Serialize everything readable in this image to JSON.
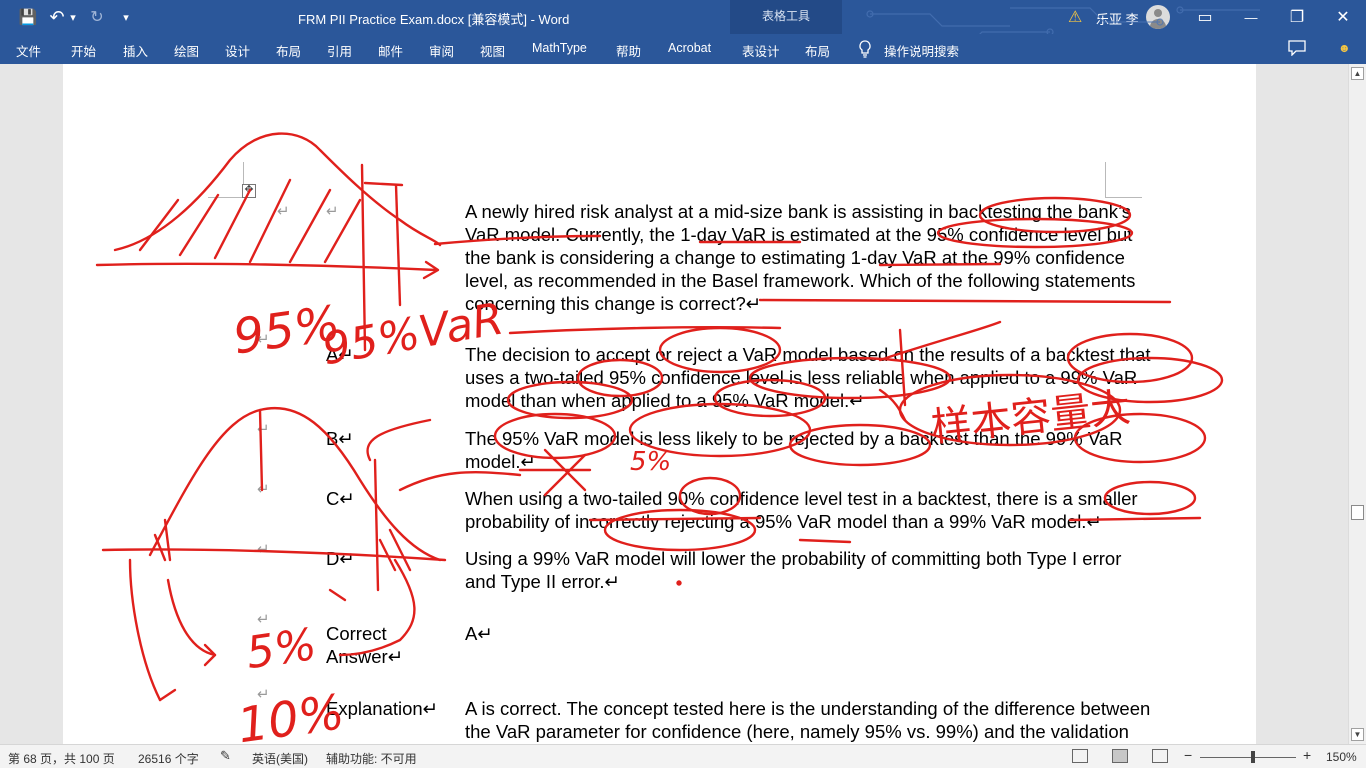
{
  "titlebar": {
    "qa_save": "💾",
    "qa_undo": "↶",
    "qa_undo_dd": "▾",
    "qa_redo": "↻",
    "qa_customize": "▾",
    "doc_title": "FRM PII Practice Exam.docx [兼容模式]  -  Word",
    "context_tab": "表格工具",
    "warning_icon": "⚠",
    "user_name": "乐亚 李",
    "ribbon_display": "▭",
    "minimize": "—",
    "restore": "❐",
    "close": "✕"
  },
  "tabs": [
    "文件",
    "开始",
    "插入",
    "绘图",
    "设计",
    "布局",
    "引用",
    "邮件",
    "审阅",
    "视图",
    "MathType",
    "帮助",
    "Acrobat",
    "表设计",
    "布局"
  ],
  "tell_me": "操作说明搜索",
  "smiley": "☻",
  "doc": {
    "question_lines": [
      "A newly hired risk analyst at a mid-size bank is assisting in backtesting the bank’s",
      "VaR model. Currently, the 1-day VaR is estimated at the 95% confidence level but",
      "the bank is considering a change to estimating 1-day VaR at the 99% confidence",
      "level, as recommended in the Basel framework. Which of the following statements",
      "concerning this change is correct?↵"
    ],
    "labels": {
      "a": "A↵",
      "b": "B↵",
      "c": "C↵",
      "d": "D↵",
      "correct1": "Correct",
      "correct2": "Answer↵",
      "explanation": "Explanation↵"
    },
    "option_a": [
      "The decision to accept or reject a VaR model based on the results of a backtest that",
      "uses a two-tailed 95% confidence level is less reliable when applied to a 99% VaR",
      "model than when applied to a 95% VaR model.↵"
    ],
    "option_b": [
      "The 95% VaR model is less likely to be rejected by a backtest than the 99% VaR",
      "model.↵"
    ],
    "option_c": [
      "When using a two-tailed 90% confidence level test in a backtest, there is a smaller",
      "probability of incorrectly rejecting a 95% VaR model than a 99% VaR model.↵"
    ],
    "option_d": [
      "Using a 99% VaR model will lower the probability of committing both Type I error",
      "and Type II error.↵"
    ],
    "answer": "A↵",
    "explanation_lines": [
      "A is correct. The concept tested here is the understanding of the difference between",
      "the VaR parameter for confidence (here, namely 95% vs. 99%) and the validation"
    ],
    "cell_mark": "↵",
    "move_handle": "✥"
  },
  "ink": {
    "color": "#e0201c",
    "handwritten_95": "95%",
    "handwritten_var": "95%VaR",
    "handwritten_5": "5%",
    "handwritten_10": "10%",
    "handwritten_5b": "5%",
    "handwritten_cn": "样本容量大"
  },
  "status": {
    "page": "第 68 页，共 100 页",
    "words": "26516 个字",
    "proof_icon": "✎",
    "language": "英语(美国)",
    "accessibility": "辅助功能: 不可用",
    "zoom_minus": "−",
    "zoom_plus": "+",
    "zoom_level": "150%",
    "zoom_fraction": 0.55
  },
  "colors": {
    "titlebar": "#2b579a",
    "ink": "#e0201c",
    "squiggle": "#c00000"
  }
}
